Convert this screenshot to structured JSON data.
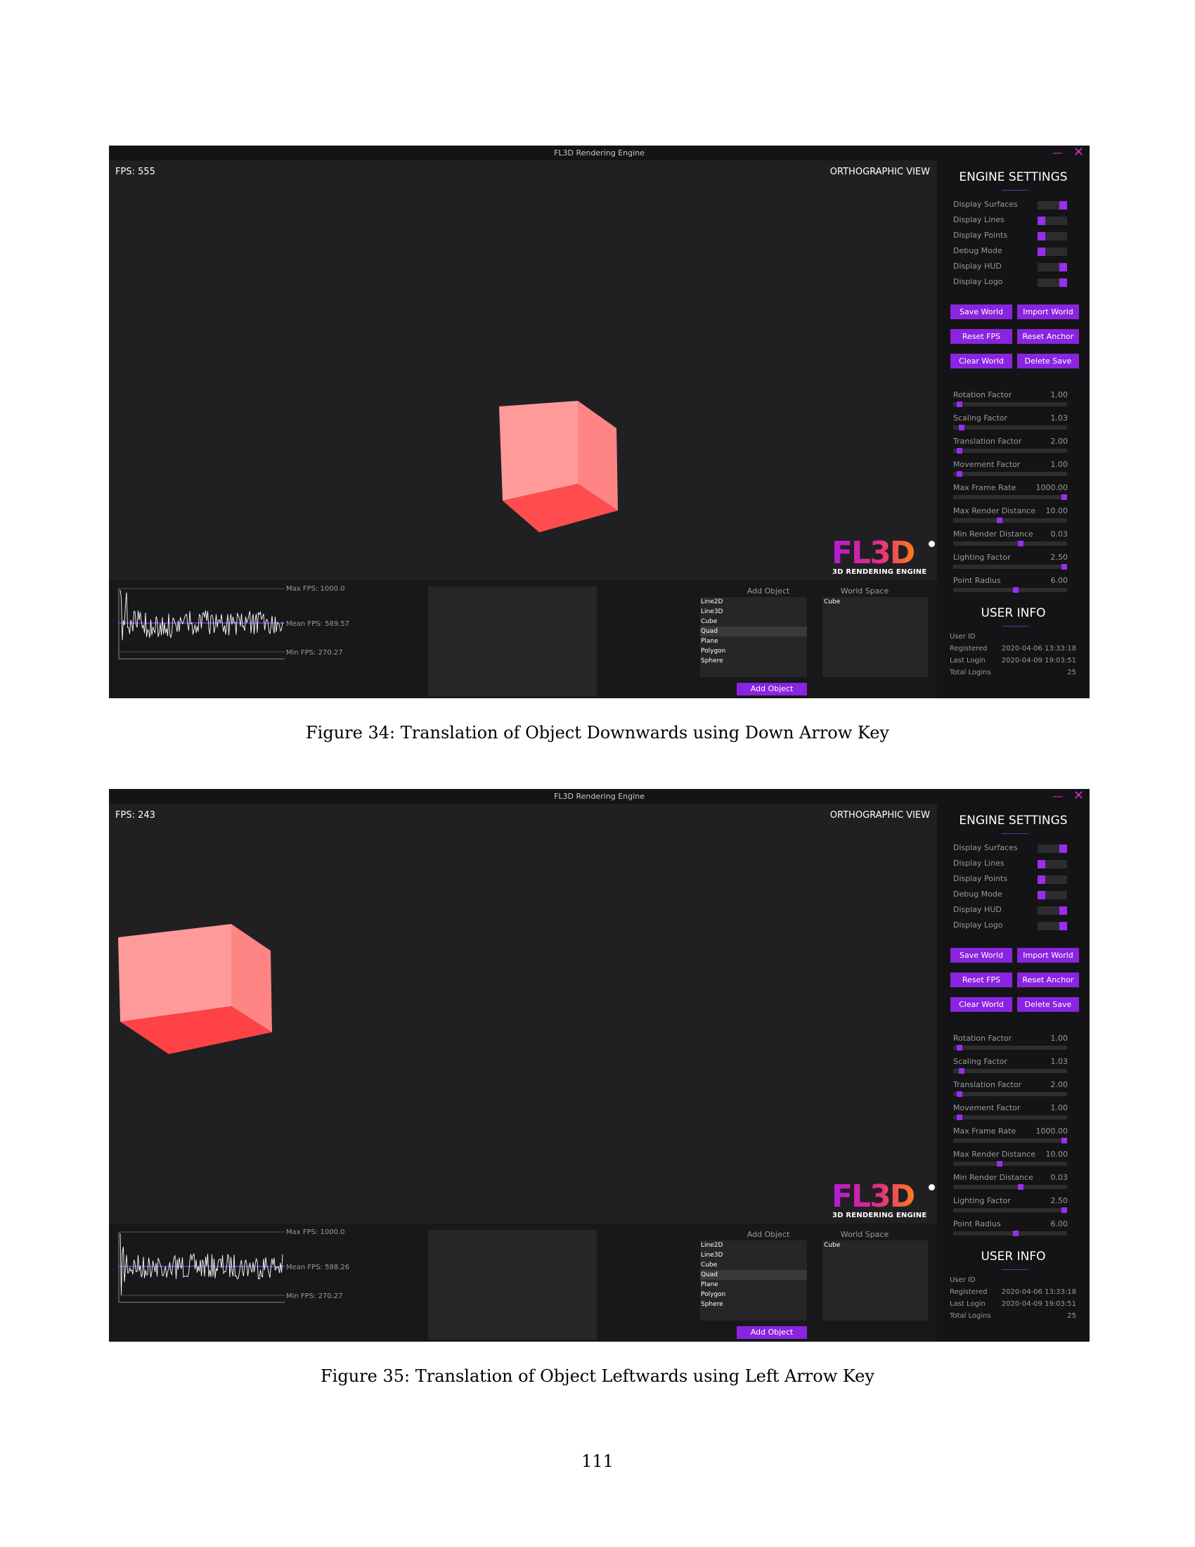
{
  "window_title": "FL3D Rendering Engine",
  "view_label": "ORTHOGRAPHIC VIEW",
  "logo": {
    "main": "FL3D",
    "sub": "3D RENDERING ENGINE"
  },
  "settings": {
    "heading": "ENGINE SETTINGS",
    "toggles": [
      {
        "label": "Display Surfaces",
        "on": true
      },
      {
        "label": "Display Lines",
        "on": false
      },
      {
        "label": "Display Points",
        "on": false
      },
      {
        "label": "Debug Mode",
        "on": false
      },
      {
        "label": "Display HUD",
        "on": true
      },
      {
        "label": "Display Logo",
        "on": true
      }
    ],
    "buttons": [
      "Save World",
      "Import World",
      "Reset FPS",
      "Reset Anchor",
      "Clear World",
      "Delete Save"
    ],
    "sliders": [
      {
        "label": "Rotation Factor",
        "value": "1.00",
        "level": 0.03
      },
      {
        "label": "Scaling Factor",
        "value": "1.03",
        "level": 0.05
      },
      {
        "label": "Translation Factor",
        "value": "2.00",
        "level": 0.03
      },
      {
        "label": "Movement Factor",
        "value": "1.00",
        "level": 0.03
      },
      {
        "label": "Max Frame Rate",
        "value": "1000.00",
        "level": 1.0
      },
      {
        "label": "Max Render Distance",
        "value": "10.00",
        "level": 0.4
      },
      {
        "label": "Min Render Distance",
        "value": "0.03",
        "level": 0.6
      },
      {
        "label": "Lighting Factor",
        "value": "2.50",
        "level": 1.0
      },
      {
        "label": "Point Radius",
        "value": "6.00",
        "level": 0.55
      }
    ]
  },
  "user_info": {
    "heading": "USER INFO",
    "rows": [
      {
        "key": "User ID",
        "value": ""
      },
      {
        "key": "Registered",
        "value": "2020-04-06 13:33:18"
      },
      {
        "key": "Last Login",
        "value": "2020-04-09 19:03:51"
      },
      {
        "key": "Total Logins",
        "value": "25"
      }
    ]
  },
  "add_object": {
    "label": "Add Object",
    "items": [
      "Line2D",
      "Line3D",
      "Cube",
      "Quad",
      "Plane",
      "Polygon",
      "Sphere"
    ],
    "selected": "Quad",
    "button": "Add Object"
  },
  "world_space": {
    "label": "World Space",
    "items": [
      "Cube"
    ]
  },
  "figures": [
    {
      "fps": "FPS: 555",
      "graph": {
        "max": "Max FPS: 1000.0",
        "mean": "Mean FPS: 589.57",
        "min": "Min FPS: 270.27"
      },
      "caption": "Figure 34: Translation of Object Downwards using Down Arrow Key"
    },
    {
      "fps": "FPS: 243",
      "graph": {
        "max": "Max FPS: 1000.0",
        "mean": "Mean FPS: 588.26",
        "min": "Min FPS: 270.27"
      },
      "caption": "Figure 35: Translation of Object Leftwards using Left Arrow Key"
    }
  ],
  "page_number": "111",
  "colors": {
    "accent": "#8a24e0",
    "cube_face_light": "#ff9a9a",
    "cube_face_side": "#ff8484",
    "cube_face_bottom": "#ff4a4a"
  }
}
